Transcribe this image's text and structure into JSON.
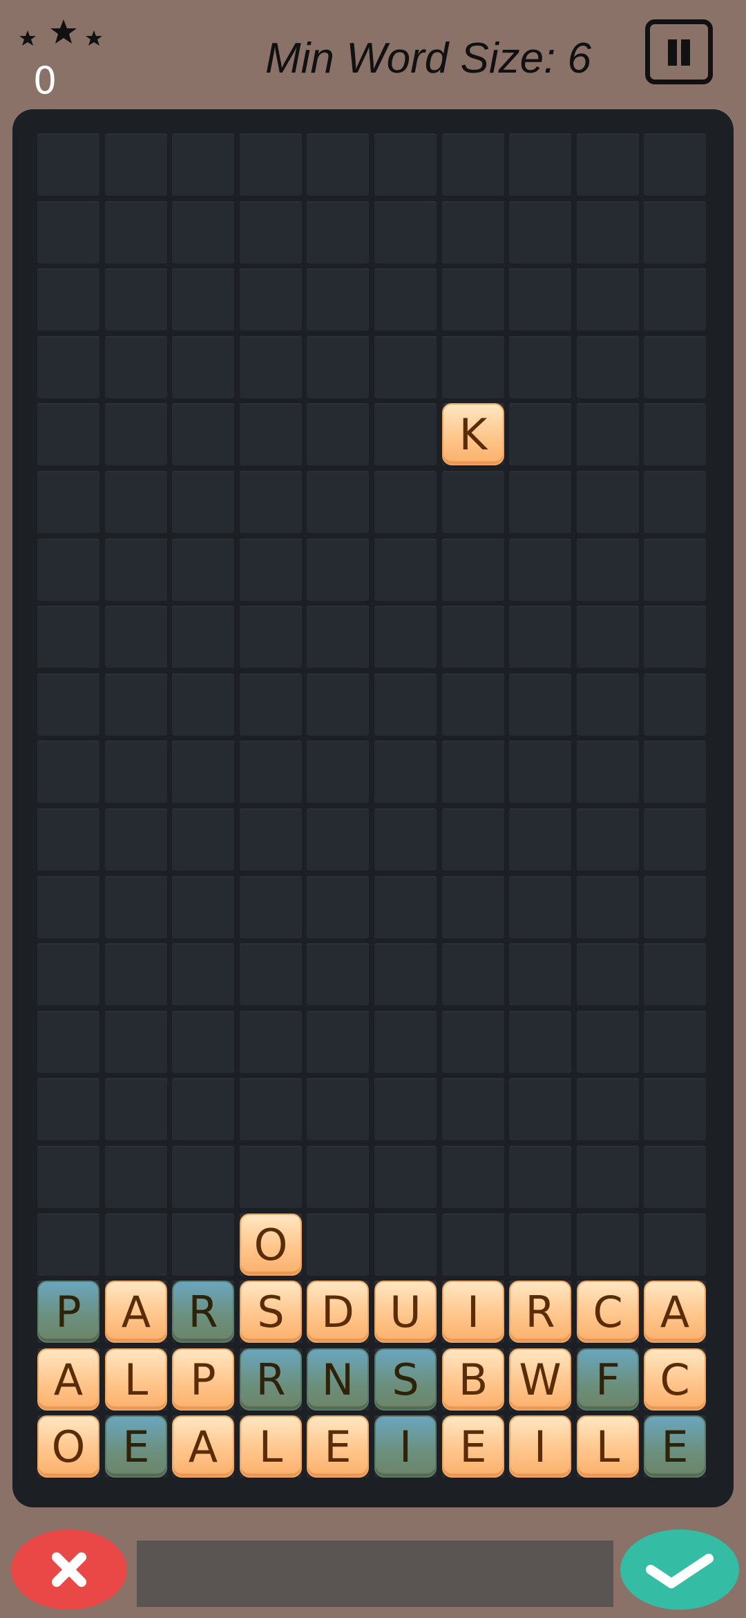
{
  "header": {
    "stars_count": 3,
    "score": "0",
    "min_word_label": "Min Word Size: 6",
    "pause_icon": "pause-icon"
  },
  "board": {
    "columns": 10,
    "rows": 20,
    "colors": {
      "board_bg": "#1c1f23",
      "cell_bg": "#262a31",
      "tile_orange": "#ffc68c",
      "tile_blue": "#6b8f7c",
      "tile_text": "#5a2d08"
    },
    "tiles": [
      {
        "row": 4,
        "col": 6,
        "letter": "K",
        "style": "orange"
      },
      {
        "row": 16,
        "col": 3,
        "letter": "O",
        "style": "orange"
      },
      {
        "row": 17,
        "col": 0,
        "letter": "P",
        "style": "blue"
      },
      {
        "row": 17,
        "col": 1,
        "letter": "A",
        "style": "orange"
      },
      {
        "row": 17,
        "col": 2,
        "letter": "R",
        "style": "blue"
      },
      {
        "row": 17,
        "col": 3,
        "letter": "S",
        "style": "orange"
      },
      {
        "row": 17,
        "col": 4,
        "letter": "D",
        "style": "orange"
      },
      {
        "row": 17,
        "col": 5,
        "letter": "U",
        "style": "orange"
      },
      {
        "row": 17,
        "col": 6,
        "letter": "I",
        "style": "orange"
      },
      {
        "row": 17,
        "col": 7,
        "letter": "R",
        "style": "orange"
      },
      {
        "row": 17,
        "col": 8,
        "letter": "C",
        "style": "orange"
      },
      {
        "row": 17,
        "col": 9,
        "letter": "A",
        "style": "orange"
      },
      {
        "row": 18,
        "col": 0,
        "letter": "A",
        "style": "orange"
      },
      {
        "row": 18,
        "col": 1,
        "letter": "L",
        "style": "orange"
      },
      {
        "row": 18,
        "col": 2,
        "letter": "P",
        "style": "orange"
      },
      {
        "row": 18,
        "col": 3,
        "letter": "R",
        "style": "blue"
      },
      {
        "row": 18,
        "col": 4,
        "letter": "N",
        "style": "blue"
      },
      {
        "row": 18,
        "col": 5,
        "letter": "S",
        "style": "blue"
      },
      {
        "row": 18,
        "col": 6,
        "letter": "B",
        "style": "orange"
      },
      {
        "row": 18,
        "col": 7,
        "letter": "W",
        "style": "orange"
      },
      {
        "row": 18,
        "col": 8,
        "letter": "F",
        "style": "blue"
      },
      {
        "row": 18,
        "col": 9,
        "letter": "C",
        "style": "orange"
      },
      {
        "row": 19,
        "col": 0,
        "letter": "O",
        "style": "orange"
      },
      {
        "row": 19,
        "col": 1,
        "letter": "E",
        "style": "blue"
      },
      {
        "row": 19,
        "col": 2,
        "letter": "A",
        "style": "orange"
      },
      {
        "row": 19,
        "col": 3,
        "letter": "L",
        "style": "orange"
      },
      {
        "row": 19,
        "col": 4,
        "letter": "E",
        "style": "orange"
      },
      {
        "row": 19,
        "col": 5,
        "letter": "I",
        "style": "blue"
      },
      {
        "row": 19,
        "col": 6,
        "letter": "E",
        "style": "orange"
      },
      {
        "row": 19,
        "col": 7,
        "letter": "I",
        "style": "orange"
      },
      {
        "row": 19,
        "col": 8,
        "letter": "L",
        "style": "orange"
      },
      {
        "row": 19,
        "col": 9,
        "letter": "E",
        "style": "blue"
      }
    ]
  },
  "controls": {
    "cancel_icon": "close-icon",
    "confirm_icon": "check-icon",
    "current_word": "",
    "cancel_color": "#ea4846",
    "confirm_color": "#34bca4"
  }
}
